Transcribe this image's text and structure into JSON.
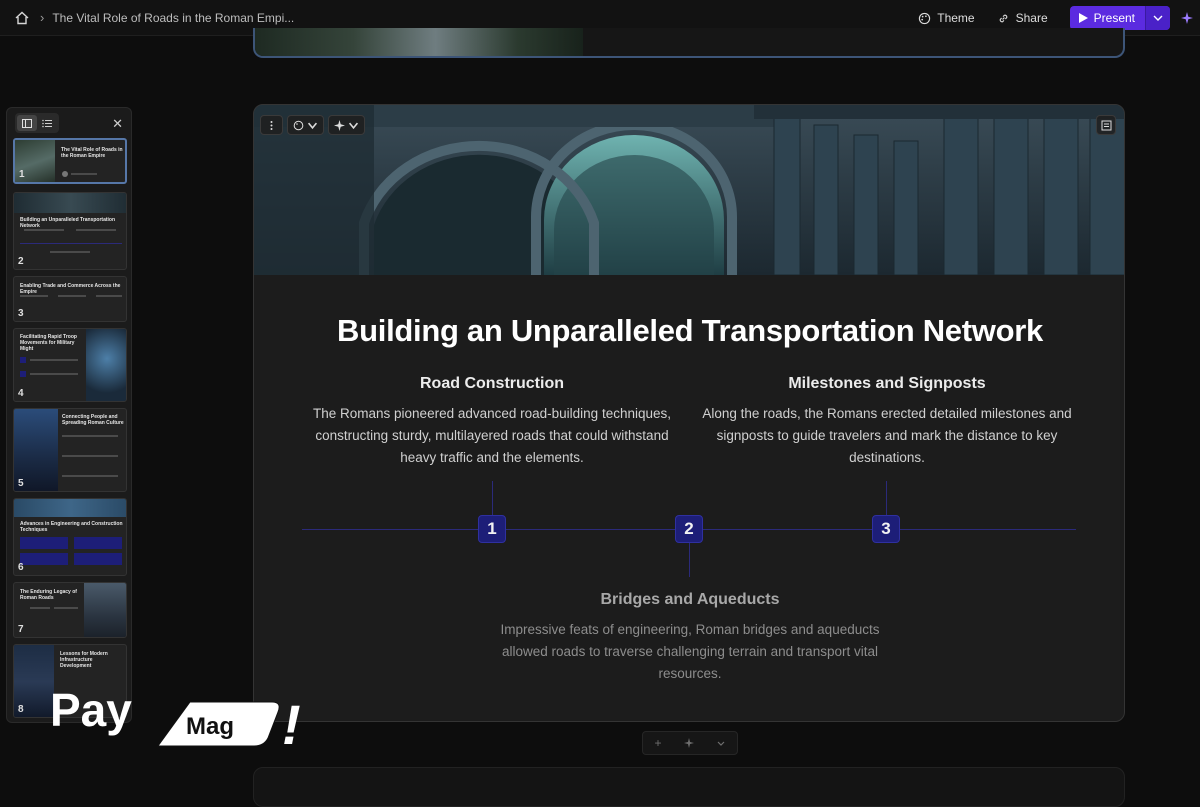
{
  "topbar": {
    "breadcrumb": "The Vital Role of Roads in the Roman Empi...",
    "theme_label": "Theme",
    "share_label": "Share",
    "present_label": "Present"
  },
  "sidebar": {
    "close_symbol": "✕",
    "thumbnails": [
      {
        "number": "1",
        "title": "The Vital Role of Roads in the Roman Empire"
      },
      {
        "number": "2",
        "title": "Building an Unparalleled Transportation Network"
      },
      {
        "number": "3",
        "title": "Enabling Trade and Commerce Across the Empire"
      },
      {
        "number": "4",
        "title": "Facilitating Rapid Troop Movements for Military Might"
      },
      {
        "number": "5",
        "title": "Connecting People and Spreading Roman Culture"
      },
      {
        "number": "6",
        "title": "Advances in Engineering and Construction Techniques"
      },
      {
        "number": "7",
        "title": "The Enduring Legacy of Roman Roads"
      },
      {
        "number": "8",
        "title": "Lessons for Modern Infrastructure Development"
      }
    ]
  },
  "slide": {
    "title": "Building an Unparalleled Transportation Network",
    "col1": {
      "title": "Road Construction",
      "text": "The Romans pioneered advanced road-building techniques, constructing sturdy, multilayered roads that could withstand heavy traffic and the elements."
    },
    "col2": {
      "title": "Milestones and Signposts",
      "text": "Along the roads, the Romans erected detailed milestones and signposts to guide travelers and mark the distance to key destinations."
    },
    "col3": {
      "title": "Bridges and Aqueducts",
      "text": "Impressive feats of engineering, Roman bridges and aqueducts allowed roads to traverse challenging terrain and transport vital resources."
    },
    "timeline": [
      "1",
      "2",
      "3"
    ]
  },
  "add_bar": {
    "plus": "+"
  },
  "watermark": {
    "word1": "Pay",
    "word2": "Mag",
    "mark": "!"
  },
  "colors": {
    "accent": "#5b2be0",
    "timeline_node": "#1d1e78",
    "selected_border": "#5677a8"
  }
}
